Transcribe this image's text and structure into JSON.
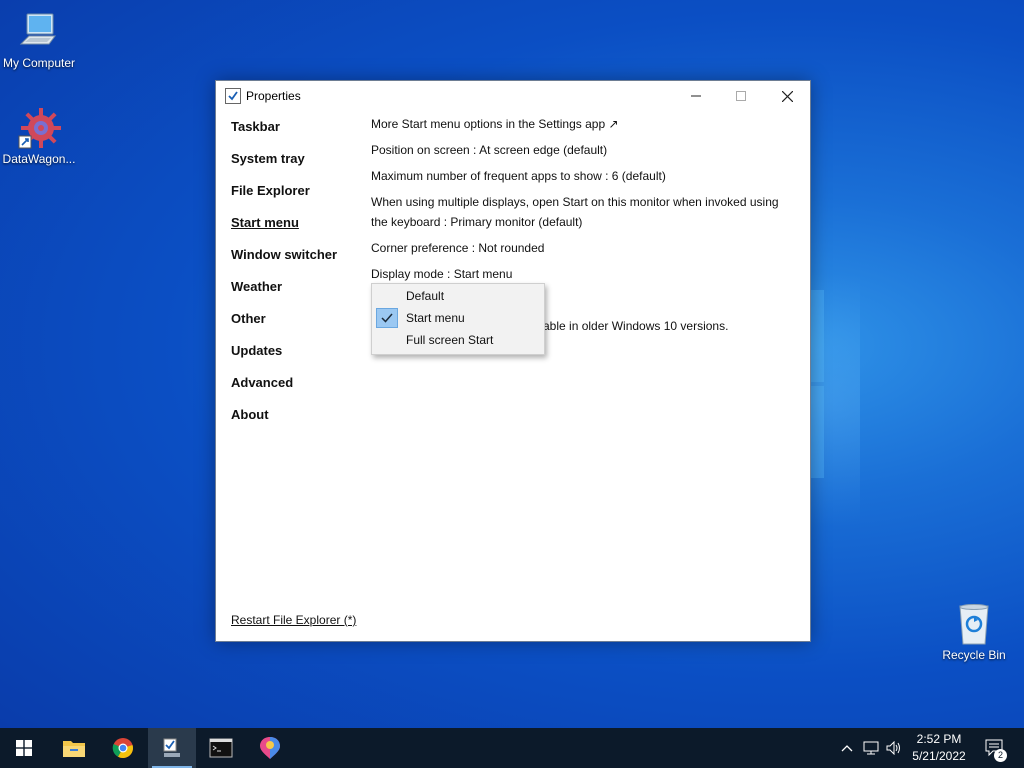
{
  "desktop": {
    "icons": [
      {
        "label": "My Computer"
      },
      {
        "label": "DataWagon..."
      },
      {
        "label": "Recycle Bin"
      }
    ]
  },
  "window": {
    "title": "Properties",
    "nav": [
      {
        "label": "Taskbar"
      },
      {
        "label": "System tray"
      },
      {
        "label": "File Explorer"
      },
      {
        "label": "Start menu"
      },
      {
        "label": "Window switcher"
      },
      {
        "label": "Weather"
      },
      {
        "label": "Other"
      },
      {
        "label": "Updates"
      },
      {
        "label": "Advanced"
      },
      {
        "label": "About"
      }
    ],
    "active_nav": "Start menu",
    "settings": {
      "more_options": "More Start menu options in the Settings app ↗",
      "position": "Position on screen : At screen edge (default)",
      "max_frequent": "Maximum number of frequent apps to show : 6 (default)",
      "multi_display_line1": "When using multiple displays, open Start on this monitor when invoked using",
      "multi_display_line2": "the keyboard : Primary monitor (default)",
      "corner": "Corner preference : Not rounded",
      "display_mode": "Display mode : Start menu",
      "partial_note": "able in older Windows 10 versions."
    },
    "restart_link": "Restart File Explorer (*)"
  },
  "dropdown": {
    "options": [
      {
        "label": "Default",
        "checked": false
      },
      {
        "label": "Start menu",
        "checked": true
      },
      {
        "label": "Full screen Start",
        "checked": false
      }
    ]
  },
  "taskbar": {
    "apps": [
      "start-icon",
      "file-explorer-icon",
      "chrome-icon",
      "properties-app-icon",
      "terminal-icon",
      "paint-icon"
    ],
    "clock": {
      "time": "2:52 PM",
      "date": "5/21/2022"
    },
    "notification_count": "2"
  },
  "colors": {
    "accent": "#0b4fc4",
    "menu_highlight": "#9bc8f2",
    "taskbar": "#0c1a2a"
  }
}
